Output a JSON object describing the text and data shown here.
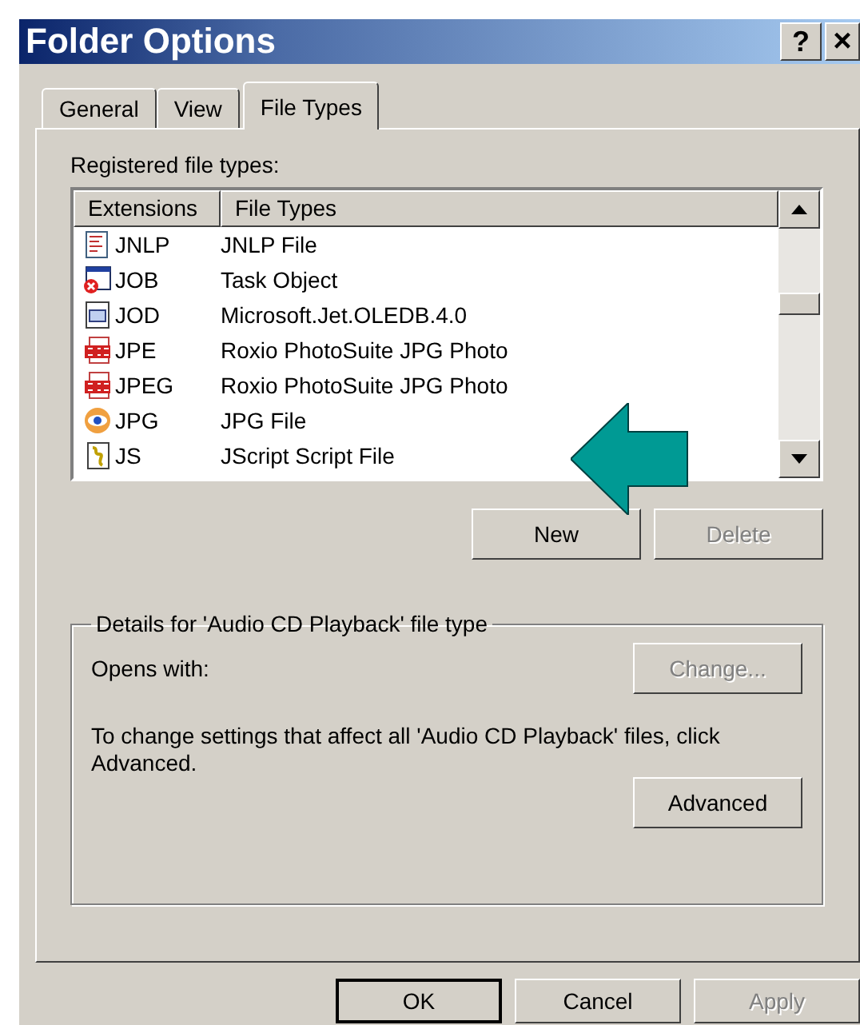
{
  "window": {
    "title": "Folder Options",
    "title_buttons": [
      {
        "label": "?",
        "kind": "help"
      },
      {
        "label": "×",
        "kind": "close"
      }
    ]
  },
  "tabs": [
    {
      "label": "General",
      "selected": false
    },
    {
      "label": "View",
      "selected": false
    },
    {
      "label": "File Types",
      "selected": true
    }
  ],
  "registered_label": "Registered file types:",
  "file_list": {
    "columns": [
      "Extensions",
      "File Types"
    ],
    "rows": [
      {
        "kind": "document",
        "extension": "JNLP",
        "file_type": "JNLP File",
        "selected": false
      },
      {
        "kind": "task",
        "extension": "JOB",
        "file_type": "Task Object",
        "selected": false
      },
      {
        "kind": "window",
        "extension": "JOD",
        "file_type": "Microsoft.Jet.OLEDB.4.0",
        "selected": false
      },
      {
        "kind": "jpg",
        "extension": "JPE",
        "file_type": "Roxio PhotoSuite JPG Photo",
        "selected": false
      },
      {
        "kind": "jpg",
        "extension": "JPEG",
        "file_type": "Roxio PhotoSuite JPG Photo",
        "selected": false
      },
      {
        "kind": "eye",
        "extension": "JPG",
        "file_type": "JPG File",
        "selected": false
      },
      {
        "kind": "script",
        "extension": "JS",
        "file_type": "JScript Script File",
        "selected": false
      }
    ]
  },
  "list_buttons": [
    {
      "label": "New",
      "disabled": false
    },
    {
      "label": "Delete",
      "disabled": true
    }
  ],
  "details": {
    "title": "Details for 'Audio CD Playback' file type",
    "opens_with": "Opens with:",
    "change_button": {
      "label": "Change...",
      "disabled": true
    },
    "description": "To change settings that affect all 'Audio CD Playback' files, click Advanced.",
    "advanced_button": {
      "label": "Advanced",
      "disabled": false
    }
  },
  "dialog_buttons": [
    {
      "label": "OK",
      "disabled": false,
      "default": true
    },
    {
      "label": "Cancel",
      "disabled": false,
      "default": false
    },
    {
      "label": "Apply",
      "disabled": true,
      "default": false
    }
  ]
}
